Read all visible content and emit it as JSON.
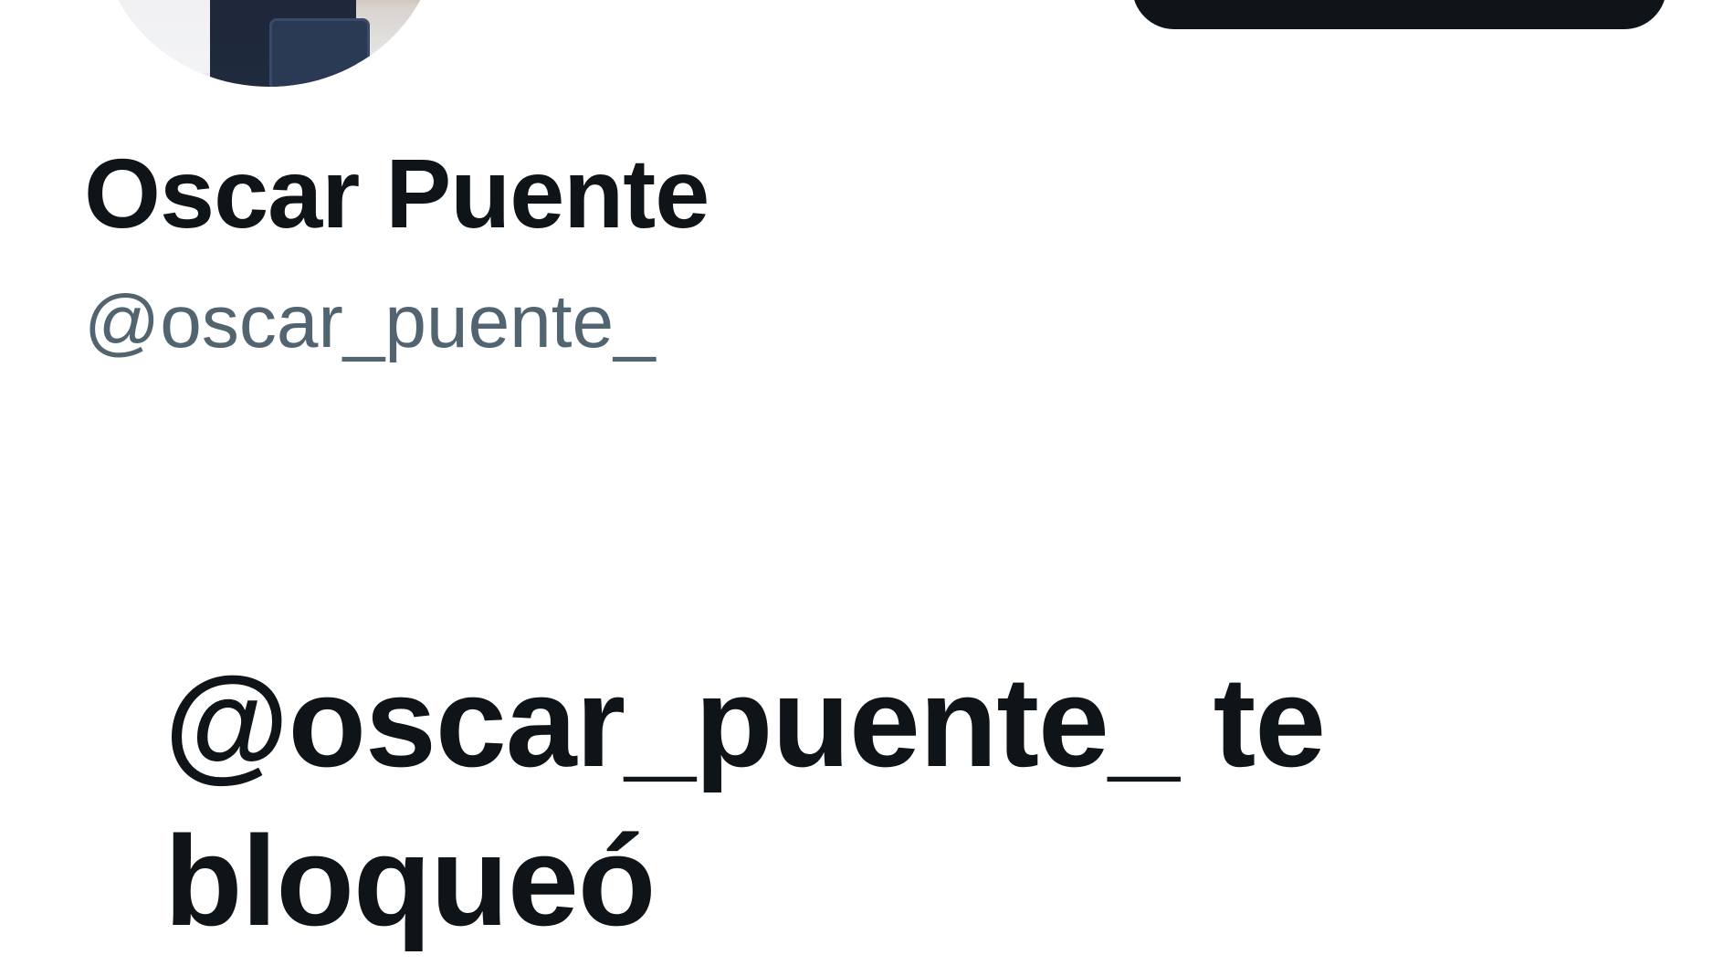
{
  "profile": {
    "name": "Oscar Puente",
    "handle": "@oscar_puente_"
  },
  "blocked": {
    "message": "@oscar_puente_ te bloqueó"
  },
  "colors": {
    "text_primary": "#0f1419",
    "text_secondary": "#536471",
    "button_background": "#0f1419",
    "background": "#ffffff"
  }
}
